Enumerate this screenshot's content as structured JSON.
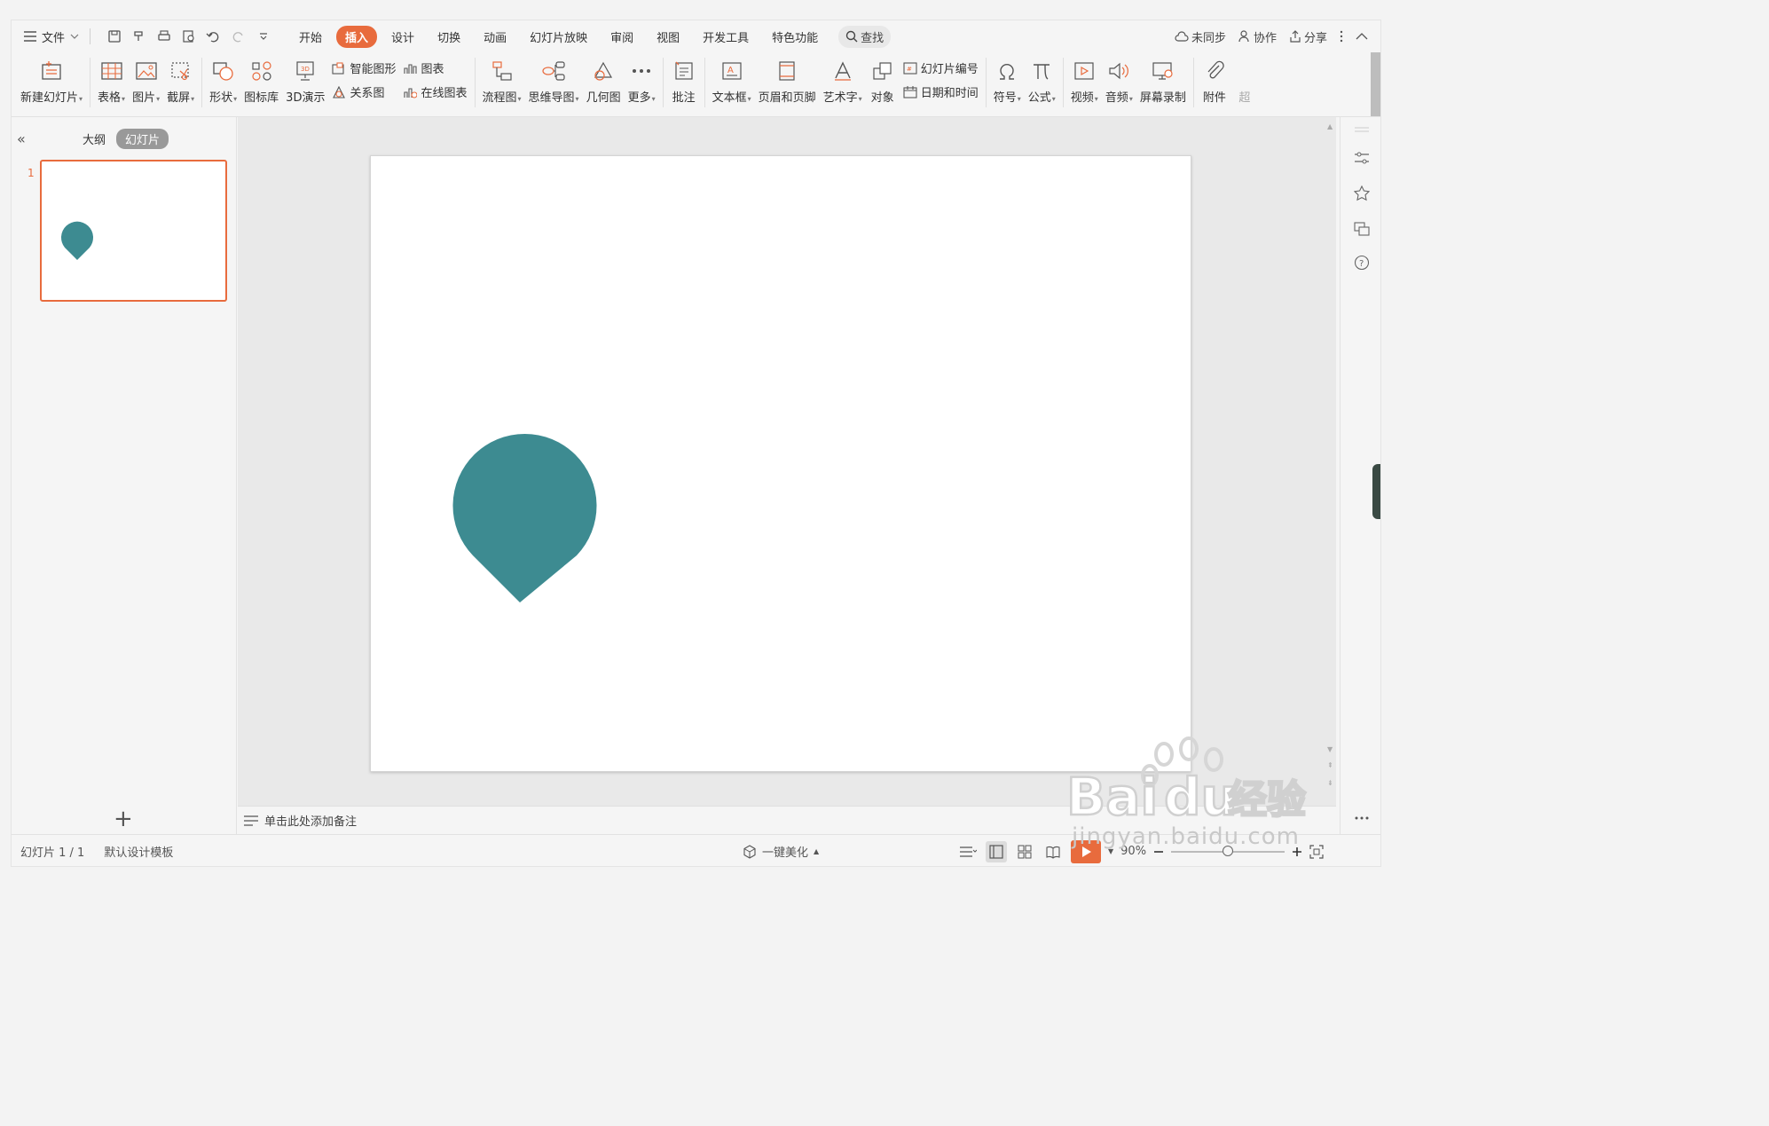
{
  "menubar": {
    "file_label": "文件",
    "tabs": [
      "开始",
      "插入",
      "设计",
      "切换",
      "动画",
      "幻灯片放映",
      "审阅",
      "视图",
      "开发工具",
      "特色功能"
    ],
    "active_tab": "插入",
    "search_label": "查找",
    "sync_label": "未同步",
    "collab_label": "协作",
    "share_label": "分享"
  },
  "ribbon": {
    "new_slide": "新建幻灯片",
    "table": "表格",
    "picture": "图片",
    "screenshot": "截屏",
    "shape": "形状",
    "icon_lib": "图标库",
    "demo3d": "3D演示",
    "smart_art": "智能图形",
    "chart": "图表",
    "relation": "关系图",
    "online_chart": "在线图表",
    "flowchart": "流程图",
    "mindmap": "思维导图",
    "geometry": "几何图",
    "more": "更多",
    "comment": "批注",
    "textbox": "文本框",
    "header_footer": "页眉和页脚",
    "wordart": "艺术字",
    "object": "对象",
    "slide_number": "幻灯片编号",
    "datetime": "日期和时间",
    "symbol": "符号",
    "formula": "公式",
    "video": "视频",
    "audio": "音频",
    "screen_record": "屏幕录制",
    "attachment": "附件",
    "overflow": "超"
  },
  "left_panel": {
    "tab_outline": "大纲",
    "tab_slides": "幻灯片",
    "slide_number": "1"
  },
  "notes": {
    "placeholder": "单击此处添加备注"
  },
  "statusbar": {
    "slide_info": "幻灯片 1 / 1",
    "template": "默认设计模板",
    "beautify": "一键美化",
    "zoom": "90%"
  },
  "slide": {
    "shape_color": "#3d8b91"
  },
  "watermark": {
    "text": "jingyan.baidu.com"
  },
  "colors": {
    "accent": "#e86b3d",
    "shape": "#3d8b91"
  }
}
